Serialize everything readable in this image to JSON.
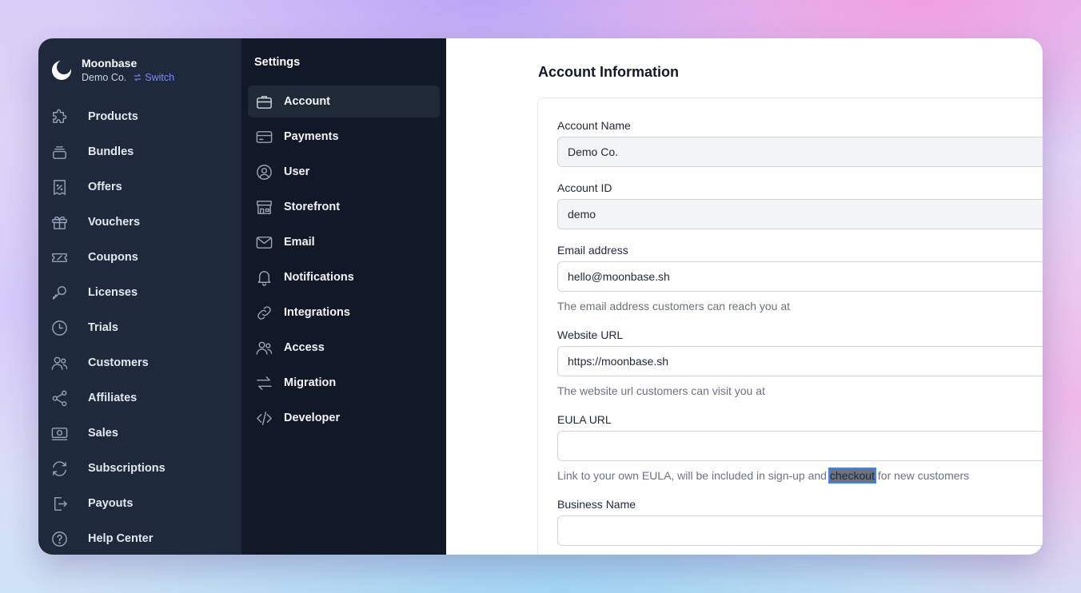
{
  "brand": {
    "name": "Moonbase",
    "org": "Demo Co.",
    "switch_label": "Switch"
  },
  "nav": {
    "items": [
      {
        "label": "Products",
        "icon": "puzzle-icon"
      },
      {
        "label": "Bundles",
        "icon": "stack-icon"
      },
      {
        "label": "Offers",
        "icon": "receipt-percent-icon"
      },
      {
        "label": "Vouchers",
        "icon": "gift-icon"
      },
      {
        "label": "Coupons",
        "icon": "ticket-icon"
      },
      {
        "label": "Licenses",
        "icon": "key-icon"
      },
      {
        "label": "Trials",
        "icon": "clock-icon"
      },
      {
        "label": "Customers",
        "icon": "users-icon"
      },
      {
        "label": "Affiliates",
        "icon": "share-icon"
      },
      {
        "label": "Sales",
        "icon": "banknotes-icon"
      },
      {
        "label": "Subscriptions",
        "icon": "refresh-icon"
      },
      {
        "label": "Payouts",
        "icon": "exit-icon"
      },
      {
        "label": "Help Center",
        "icon": "question-icon"
      }
    ]
  },
  "settings": {
    "title": "Settings",
    "items": [
      {
        "label": "Account",
        "icon": "briefcase-icon",
        "active": true
      },
      {
        "label": "Payments",
        "icon": "credit-card-icon"
      },
      {
        "label": "User",
        "icon": "user-circle-icon"
      },
      {
        "label": "Storefront",
        "icon": "storefront-icon"
      },
      {
        "label": "Email",
        "icon": "envelope-icon"
      },
      {
        "label": "Notifications",
        "icon": "bell-icon"
      },
      {
        "label": "Integrations",
        "icon": "link-icon"
      },
      {
        "label": "Access",
        "icon": "users-icon"
      },
      {
        "label": "Migration",
        "icon": "arrows-icon"
      },
      {
        "label": "Developer",
        "icon": "code-icon"
      }
    ]
  },
  "account": {
    "title": "Account Information",
    "account_name": {
      "label": "Account Name",
      "value": "Demo Co."
    },
    "account_id": {
      "label": "Account ID",
      "value": "demo"
    },
    "email": {
      "label": "Email address",
      "value": "hello@moonbase.sh",
      "help": "The email address customers can reach you at"
    },
    "website": {
      "label": "Website URL",
      "value": "https://moonbase.sh",
      "help": "The website url customers can visit you at"
    },
    "eula": {
      "label": "EULA URL",
      "value": "",
      "help_before": "Link to your own EULA, will be included in sign-up and ",
      "help_highlight": "checkout",
      "help_after": " for new customers"
    },
    "business_name": {
      "label": "Business Name",
      "value": ""
    }
  }
}
